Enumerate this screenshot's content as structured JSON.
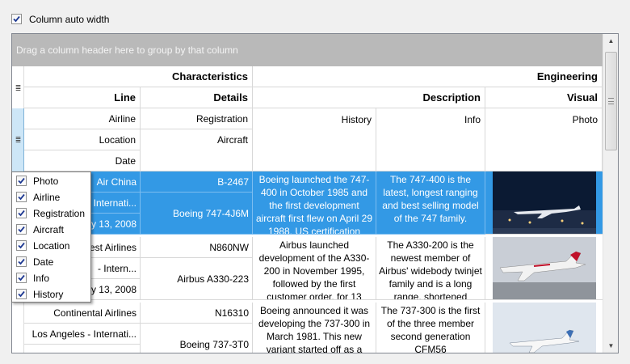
{
  "options": {
    "auto_width_label": "Column auto width",
    "auto_width_checked": true
  },
  "grid": {
    "group_panel_text": "Drag a column header here to group by that column",
    "bands": {
      "characteristics": "Characteristics",
      "engineering": "Engineering"
    },
    "subbands": {
      "line": "Line",
      "details": "Details",
      "description": "Description",
      "visual": "Visual"
    },
    "columns": {
      "airline": "Airline",
      "registration": "Registration",
      "history": "History",
      "info": "Info",
      "photo": "Photo",
      "location": "Location",
      "aircraft": "Aircraft",
      "date": "Date"
    },
    "rows": [
      {
        "airline": "Air China",
        "location": "Internati...",
        "date": "y 13, 2008",
        "registration": "B-2467",
        "aircraft": "Boeing 747-4J6M",
        "history": "Boeing launched the 747-400 in October 1985 and the first development aircraft first flew on April 29 1988. US certification",
        "info": "The 747-400 is the latest, longest ranging and best selling model of the 747 family."
      },
      {
        "airline": "est Airlines",
        "location": "- Intern...",
        "date": "y 13, 2008",
        "registration": "N860NW",
        "aircraft": "Airbus A330-223",
        "history": "Airbus launched development of the A330-200 in November 1995, followed by the first customer order, for 13",
        "info": "The A330-200 is the newest member of Airbus' widebody twinjet family and is a long range, shortened"
      },
      {
        "airline": "Continental Airlines",
        "location": "Los Angeles - Internati...",
        "date": "",
        "registration": "N16310",
        "aircraft": "Boeing 737-3T0",
        "history": "Boeing announced it was developing the 737-300 in March 1981. This new variant started off as a",
        "info": "The 737-300 is the first of the three member second generation CFM56"
      }
    ]
  },
  "customization": {
    "items": [
      {
        "label": "Photo",
        "checked": true
      },
      {
        "label": "Airline",
        "checked": true
      },
      {
        "label": "Registration",
        "checked": true
      },
      {
        "label": "Aircraft",
        "checked": true
      },
      {
        "label": "Location",
        "checked": true
      },
      {
        "label": "Date",
        "checked": true
      },
      {
        "label": "Info",
        "checked": true
      },
      {
        "label": "History",
        "checked": true
      }
    ]
  },
  "colors": {
    "selection": "#3399e5",
    "group_panel": "#b9b9b9",
    "grid_line": "#d8d8d8"
  }
}
